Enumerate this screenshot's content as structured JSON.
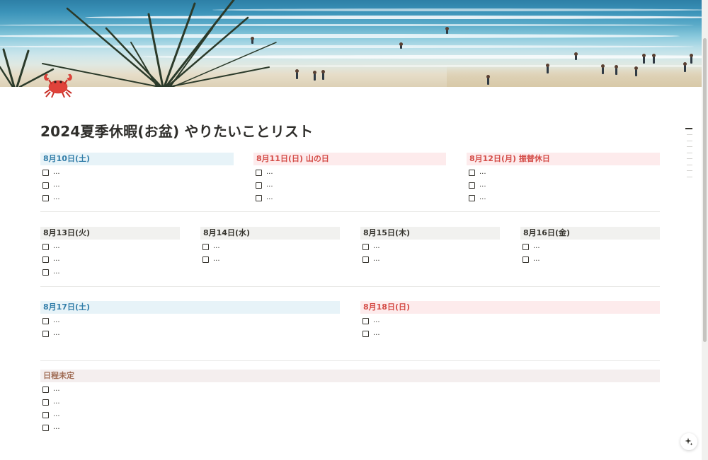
{
  "page": {
    "title": "2024夏季休暇(お盆) やりたいことリスト",
    "icon": "crab-icon"
  },
  "sections": {
    "week1": [
      {
        "heading": "8月10日(土)",
        "tone": "sat",
        "todos": [
          "...",
          "...",
          "..."
        ]
      },
      {
        "heading": "8月11日(日) 山の日",
        "tone": "sun",
        "todos": [
          "...",
          "...",
          "..."
        ]
      },
      {
        "heading": "8月12日(月) 振替休日",
        "tone": "sun",
        "todos": [
          "...",
          "...",
          "..."
        ]
      }
    ],
    "week2": [
      {
        "heading": "8月13日(火)",
        "tone": "wk",
        "todos": [
          "...",
          "...",
          "..."
        ]
      },
      {
        "heading": "8月14日(水)",
        "tone": "wk",
        "todos": [
          "...",
          "..."
        ]
      },
      {
        "heading": "8月15日(木)",
        "tone": "wk",
        "todos": [
          "...",
          "..."
        ]
      },
      {
        "heading": "8月16日(金)",
        "tone": "wk",
        "todos": [
          "...",
          "..."
        ]
      }
    ],
    "week3": [
      {
        "heading": "8月17日(土)",
        "tone": "sat",
        "todos": [
          "...",
          "..."
        ]
      },
      {
        "heading": "8月18日(日)",
        "tone": "sun",
        "todos": [
          "...",
          "..."
        ]
      }
    ],
    "undecided": {
      "heading": "日程未定",
      "tone": "tbd",
      "todos": [
        "...",
        "...",
        "...",
        "..."
      ]
    }
  },
  "colors": {
    "saturday_bg": "#e7f3f8",
    "saturday_text": "#337ea9",
    "holiday_bg": "#fdebec",
    "holiday_text": "#d44c47",
    "weekday_bg": "#f1f1ef",
    "weekday_text": "#37352f",
    "undecided_bg": "#f4eeee",
    "undecided_text": "#9f6b53"
  }
}
